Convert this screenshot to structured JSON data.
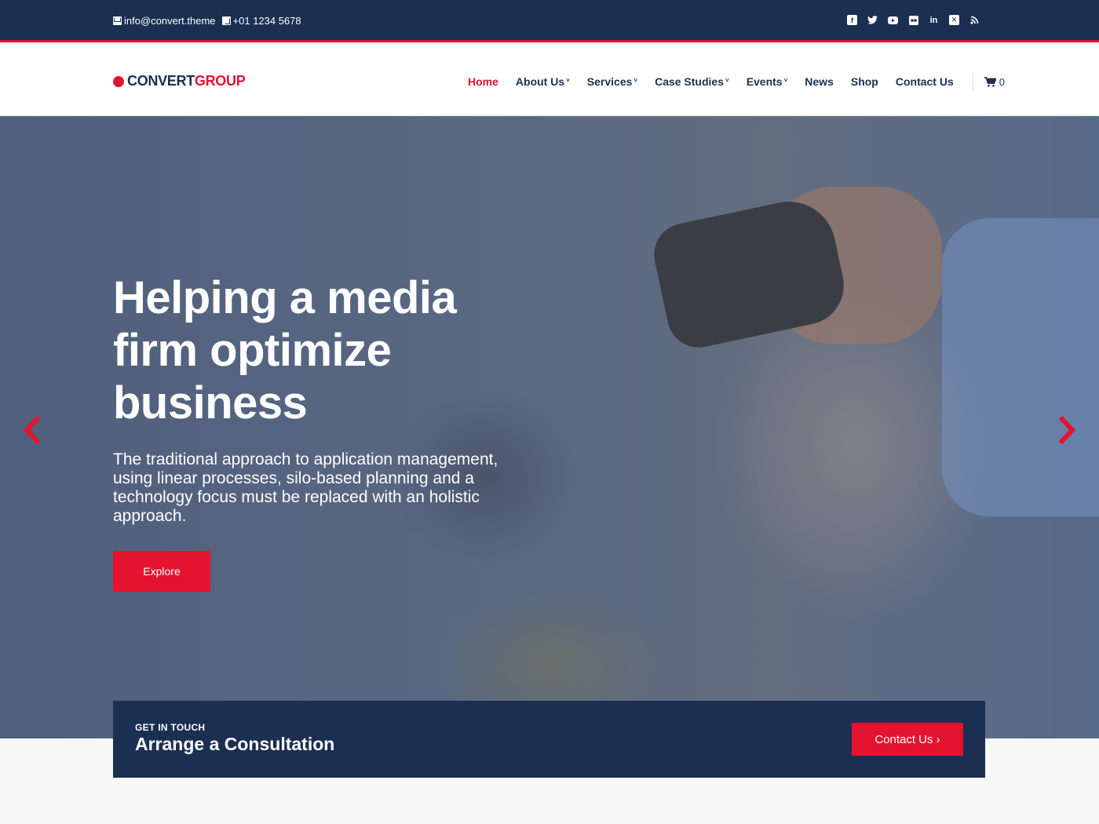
{
  "topbar": {
    "email": "info@convert.theme",
    "phone": "+01 1234 5678",
    "social": [
      "facebook-icon",
      "twitter-icon",
      "youtube-icon",
      "flickr-icon",
      "linkedin-icon",
      "xing-icon",
      "rss-icon"
    ]
  },
  "brand": {
    "part1": "CONVERT",
    "part2": "GROUP"
  },
  "nav": {
    "items": [
      {
        "label": "Home",
        "active": true
      },
      {
        "label": "About Us",
        "dropdown": true
      },
      {
        "label": "Services",
        "dropdown": true
      },
      {
        "label": "Case Studies",
        "dropdown": true
      },
      {
        "label": "Events",
        "dropdown": true
      },
      {
        "label": "News"
      },
      {
        "label": "Shop"
      },
      {
        "label": "Contact Us"
      }
    ],
    "cart_count": "0"
  },
  "hero": {
    "title": "Helping a media firm optimize business",
    "subtitle": "The traditional approach to application management, using linear processes, silo-based planning and a technology focus must be replaced with an holistic approach.",
    "button": "Explore"
  },
  "cta": {
    "kicker": "GET IN TOUCH",
    "title": "Arrange a Consultation",
    "button": "Contact Us ›"
  },
  "colors": {
    "navy": "#1b2f52",
    "accent": "#e4132f"
  }
}
